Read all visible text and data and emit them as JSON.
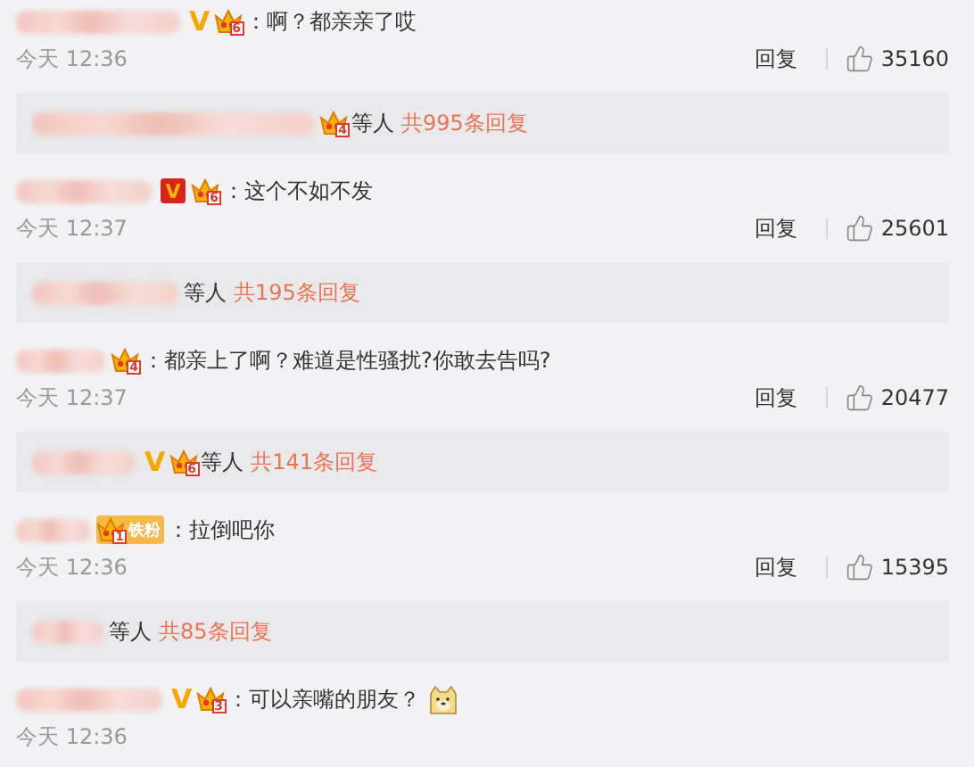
{
  "comments": [
    {
      "badges": [
        {
          "kind": "verified",
          "label": "V"
        },
        {
          "kind": "crown",
          "level": "6"
        }
      ],
      "text": "：啊？都亲亲了哎",
      "time": "今天 12:36",
      "reply_action": "回复",
      "likes": "35160",
      "thread": {
        "badges": [
          {
            "kind": "crown",
            "level": "4"
          }
        ],
        "suffix": "等人",
        "count_link": "共995条回复"
      }
    },
    {
      "badges": [
        {
          "kind": "verified_boxed",
          "label": "V"
        },
        {
          "kind": "crown",
          "level": "6"
        }
      ],
      "text": "：这个不如不发",
      "time": "今天 12:37",
      "reply_action": "回复",
      "likes": "25601",
      "thread": {
        "suffix": "等人",
        "count_link": "共195条回复"
      }
    },
    {
      "badges": [
        {
          "kind": "crown",
          "level": "4"
        }
      ],
      "text": "：都亲上了啊？难道是性骚扰?你敢去告吗?",
      "time": "今天 12:37",
      "reply_action": "回复",
      "likes": "20477",
      "thread": {
        "badges": [
          {
            "kind": "verified",
            "label": "V"
          },
          {
            "kind": "crown",
            "level": "6"
          }
        ],
        "suffix": "等人",
        "count_link": "共141条回复"
      }
    },
    {
      "badges": [
        {
          "kind": "fan",
          "level": "1",
          "label": "铁粉"
        }
      ],
      "text": "：拉倒吧你",
      "time": "今天 12:36",
      "reply_action": "回复",
      "likes": "15395",
      "thread": {
        "suffix": "等人",
        "count_link": "共85条回复"
      }
    },
    {
      "badges": [
        {
          "kind": "verified",
          "label": "V"
        },
        {
          "kind": "crown",
          "level": "3"
        }
      ],
      "text": "：可以亲嘴的朋友？",
      "emoji": true,
      "time": "今天 12:36"
    }
  ]
}
